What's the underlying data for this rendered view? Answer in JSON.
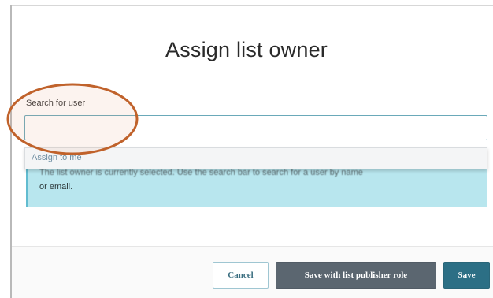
{
  "dialog": {
    "title": "Assign list owner"
  },
  "search": {
    "label": "Search for user",
    "value": "",
    "placeholder": ""
  },
  "dropdown": {
    "items": [
      {
        "label": "Assign to me"
      }
    ]
  },
  "info": {
    "line1": "The list owner is currently selected. Use the search bar to search for a user by name",
    "line2": "or email."
  },
  "footer": {
    "cancel_label": "Cancel",
    "publisher_label": "Save with list publisher role",
    "save_label": "Save"
  },
  "colors": {
    "annotation_ring": "#c0622b",
    "primary_button": "#2c6f85",
    "secondary_button": "#5b6670",
    "info_background": "#b8e6ee"
  }
}
